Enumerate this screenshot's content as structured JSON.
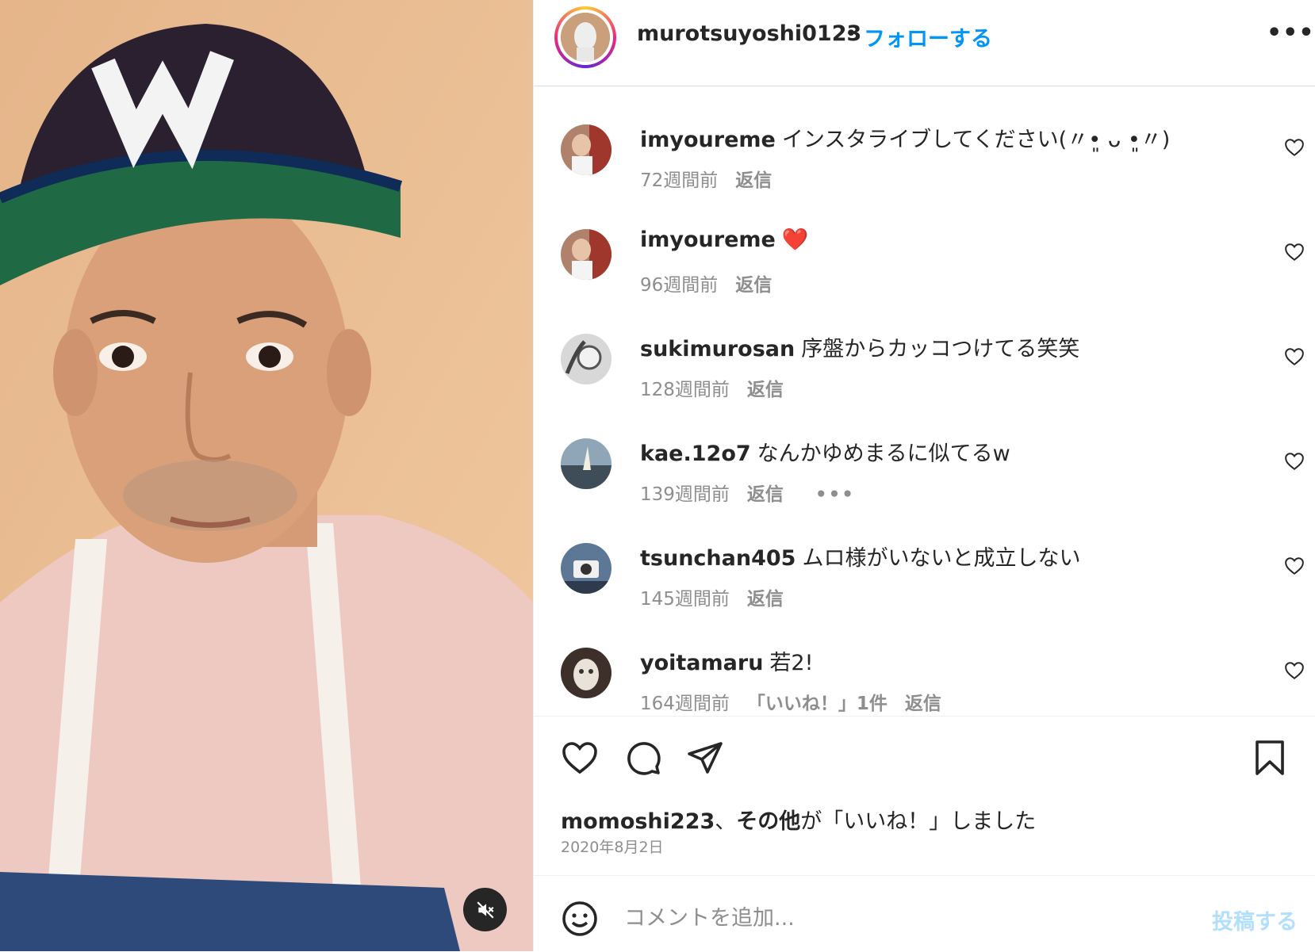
{
  "post": {
    "username": "murotsuyoshi0123",
    "separator": "•",
    "follow_label": "フォローする",
    "more_label": "•••"
  },
  "comments": [
    {
      "username": "imyoureme",
      "text": "インスタライブしてください(〃•͈ ᴗ •͈〃)",
      "time": "72週間前",
      "reply": "返信",
      "likes": "",
      "avatar_color": "#b0816b"
    },
    {
      "username": "imyoureme",
      "text": "❤️",
      "time": "96週間前",
      "reply": "返信",
      "likes": "",
      "avatar_color": "#b0816b"
    },
    {
      "username": "sukimurosan",
      "text": "序盤からカッコつけてる笑笑",
      "time": "128週間前",
      "reply": "返信",
      "likes": "",
      "avatar_color": "#9a9a9a"
    },
    {
      "username": "kae.12o7",
      "text": "なんかゆめまるに似てるw",
      "time": "139週間前",
      "reply": "返信",
      "likes": "",
      "more": "•••",
      "avatar_color": "#7b93a6"
    },
    {
      "username": "tsunchan405",
      "text": "ムロ様がいないと成立しない",
      "time": "145週間前",
      "reply": "返信",
      "likes": "",
      "avatar_color": "#6d86a5"
    },
    {
      "username": "yoitamaru",
      "text": "若2!",
      "time": "164週間前",
      "reply": "返信",
      "likes": "「いいね！」1件",
      "avatar_color": "#4a3a34"
    }
  ],
  "likes": {
    "liker": "momoshi223",
    "sep": "、",
    "others": "その他",
    "suffix": "が「いいね！」しました"
  },
  "date": "2020年8月2日",
  "add_comment": {
    "placeholder": "コメントを追加...",
    "post_label": "投稿する"
  },
  "colors": {
    "accent": "#0095f6",
    "post_disabled": "#b2dffc",
    "muted": "#8e8e8e",
    "like_red": "#ed4956"
  },
  "icons": {
    "mute": "speaker-muted-icon",
    "like": "heart-outline-icon",
    "comment": "comment-bubble-icon",
    "share": "paper-plane-icon",
    "save": "bookmark-icon",
    "emoji": "smiley-icon"
  }
}
